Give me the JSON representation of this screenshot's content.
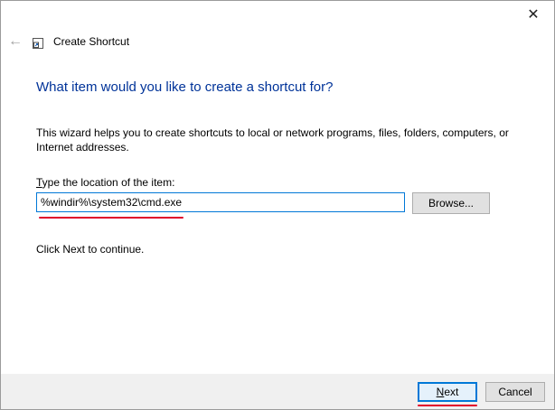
{
  "window": {
    "title": "Create Shortcut",
    "close_glyph": "✕",
    "back_glyph": "←"
  },
  "wizard": {
    "heading": "What item would you like to create a shortcut for?",
    "description": "This wizard helps you to create shortcuts to local or network programs, files, folders, computers, or Internet addresses.",
    "field_label_accel": "T",
    "field_label_rest": "ype the location of the item:",
    "location_value": "%windir%\\system32\\cmd.exe",
    "browse_accel": "",
    "browse_label": "Browse...",
    "continue_text": "Click Next to continue."
  },
  "buttons": {
    "next_accel": "N",
    "next_rest": "ext",
    "cancel_label": "Cancel"
  },
  "icons": {
    "back": "back-arrow-icon",
    "app": "shortcut-app-icon",
    "close": "close-icon"
  },
  "colors": {
    "heading": "#003399",
    "highlight_underline": "#e0002a",
    "focus_border": "#0078d7"
  }
}
